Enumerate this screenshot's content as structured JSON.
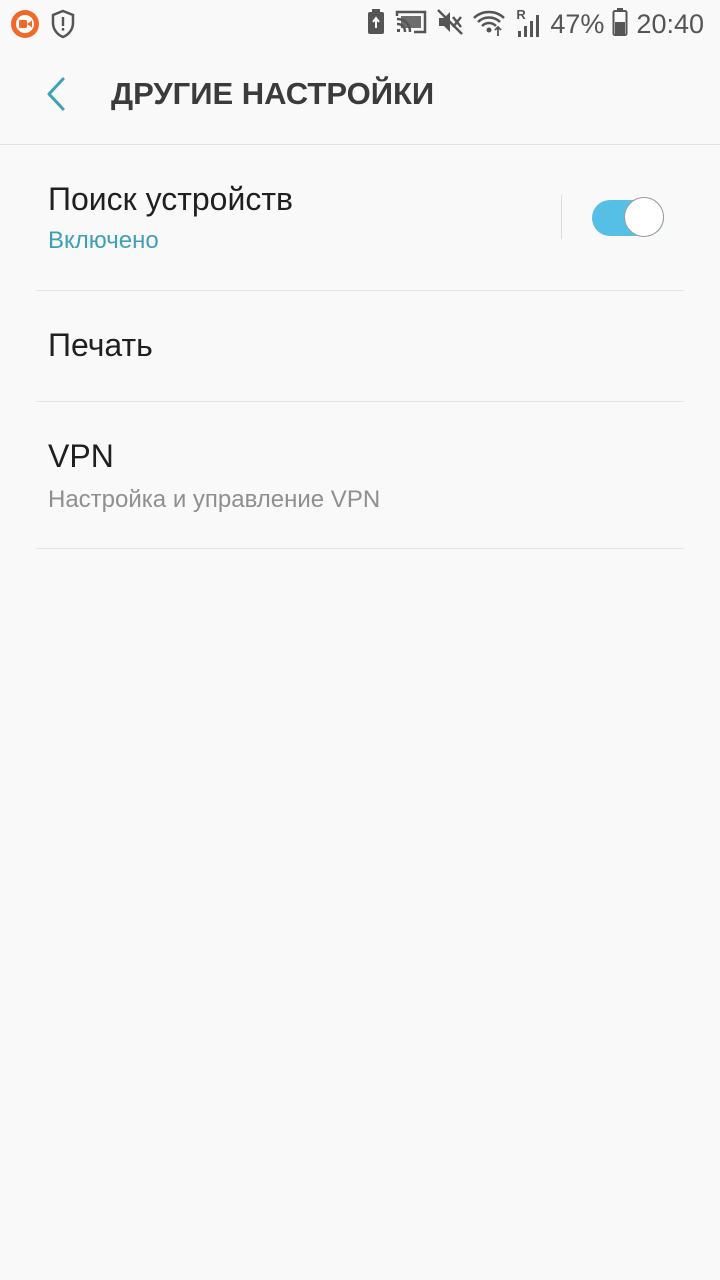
{
  "status_bar": {
    "battery_percent": "47%",
    "time": "20:40",
    "network_badge": "R",
    "icons": [
      "screen-recorder-icon",
      "shield-icon",
      "battery-saver-icon",
      "cast-icon",
      "mute-icon",
      "wifi-icon",
      "signal-icon",
      "battery-icon"
    ]
  },
  "header": {
    "title": "ДРУГИЕ НАСТРОЙКИ",
    "back_icon": "back-arrow-icon"
  },
  "items": [
    {
      "title": "Поиск устройств",
      "subtitle": "Включено",
      "toggle_on": true
    },
    {
      "title": "Печать"
    },
    {
      "title": "VPN",
      "subtitle": "Настройка и управление VPN"
    }
  ],
  "colors": {
    "accent": "#3f9fb9",
    "toggle_track": "#56bfe6",
    "subtitle_grey": "#8f8f8f",
    "background": "#f9f9f9",
    "recorder_orange": "#f2682a"
  }
}
